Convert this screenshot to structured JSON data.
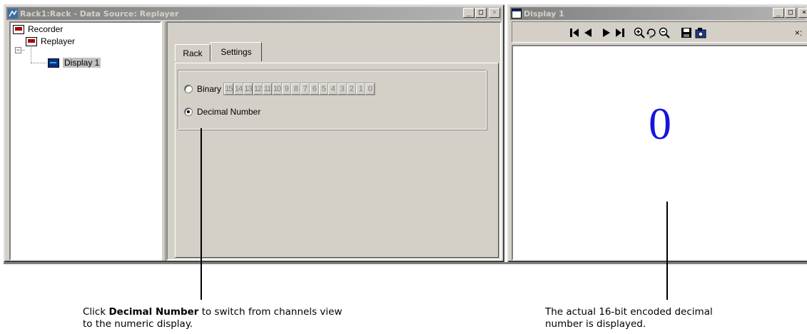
{
  "left_window": {
    "title": "Rack1:Rack - Data Source: Replayer",
    "buttons": {
      "minimize": "_",
      "maximize": "□",
      "close": "×"
    },
    "tree": {
      "items": [
        {
          "label": "Recorder",
          "icon": "recorder-icon"
        },
        {
          "label": "Replayer",
          "icon": "replayer-icon"
        },
        {
          "label": "Display 1",
          "icon": "display-icon"
        }
      ],
      "expander": "−"
    },
    "tabs": [
      {
        "label": "Rack"
      },
      {
        "label": "Settings",
        "active": true
      }
    ],
    "settings": {
      "binary_label": "Binary",
      "binary_selected": false,
      "bits": [
        "15",
        "14",
        "13",
        "12",
        "11",
        "10",
        "9",
        "8",
        "7",
        "6",
        "5",
        "4",
        "3",
        "2",
        "1",
        "0"
      ],
      "decimal_label": "Decimal Number",
      "decimal_selected": true
    }
  },
  "right_window": {
    "title": "Display 1",
    "buttons": {
      "minimize": "_",
      "maximize": "□",
      "close": "×"
    },
    "toolbar": {
      "icons": [
        "first-frame-icon",
        "step-back-icon",
        "step-forward-icon",
        "last-frame-icon",
        "zoom-in-icon",
        "zoom-reset-icon",
        "zoom-out-icon",
        "save-icon",
        "snapshot-icon"
      ],
      "overflow_text": "×:"
    },
    "value": "0"
  },
  "callouts": {
    "left": {
      "prefix": "Click ",
      "bold": "Decimal Number",
      "suffix": " to switch from channels view",
      "line2": "to the numeric display."
    },
    "right": {
      "line1": "The actual 16-bit encoded decimal",
      "line2": "number is displayed."
    }
  },
  "colors": {
    "value_blue": "#1414e0",
    "titlebar_inactive": "#808080",
    "window_face": "#d4d0c8"
  }
}
